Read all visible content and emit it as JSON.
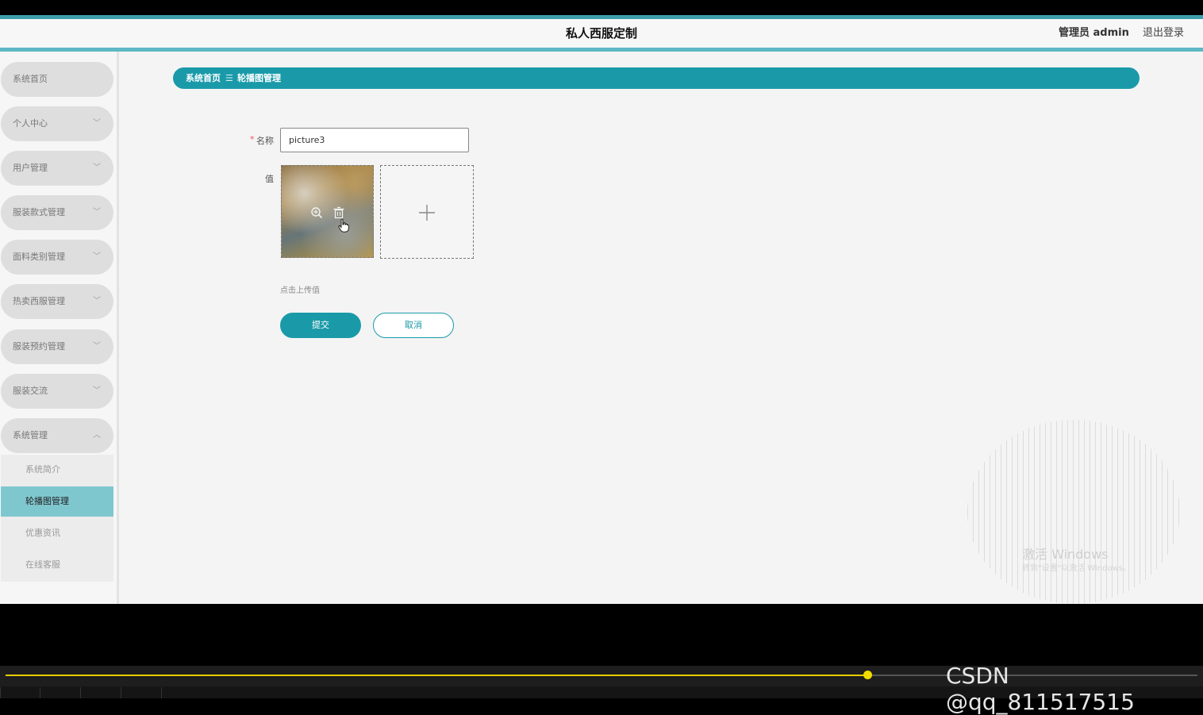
{
  "header": {
    "title": "私人西服定制",
    "user": "管理员 admin",
    "logout": "退出登录"
  },
  "sidebar": {
    "items": [
      {
        "label": "系统首页",
        "chevron": ""
      },
      {
        "label": "个人中心",
        "chevron": "﹀"
      },
      {
        "label": "用户管理",
        "chevron": "﹀"
      },
      {
        "label": "服装款式管理",
        "chevron": "﹀"
      },
      {
        "label": "面料类别管理",
        "chevron": "﹀"
      },
      {
        "label": "热卖西服管理",
        "chevron": "﹀"
      },
      {
        "label": "服装预约管理",
        "chevron": "﹀"
      },
      {
        "label": "服装交流",
        "chevron": "﹀"
      },
      {
        "label": "系统管理",
        "chevron": "︿"
      }
    ],
    "submenu": [
      {
        "label": "系统简介",
        "active": false
      },
      {
        "label": "轮播图管理",
        "active": true
      },
      {
        "label": "优惠资讯",
        "active": false
      },
      {
        "label": "在线客服",
        "active": false
      }
    ]
  },
  "breadcrumb": {
    "home": "系统首页",
    "separator": "☰",
    "current": "轮播图管理"
  },
  "form": {
    "required_mark": "*",
    "name_label": "名称",
    "name_value": "picture3",
    "value_label": "值",
    "upload_tip": "点击上传值",
    "submit": "提交",
    "cancel": "取消"
  },
  "watermark": {
    "title": "激活 Windows",
    "subtitle": "转到\"设置\"以激活 Windows。"
  },
  "player": {
    "progress": 0.723,
    "credit": "CSDN @qq_811517515"
  },
  "colors": {
    "accent": "#1a9aa9",
    "active_menu": "#7fc7cf",
    "progress": "#e5cf00"
  },
  "icons": [
    "zoom-in-icon",
    "delete-icon",
    "plus-icon",
    "chevron-down-icon",
    "chevron-up-icon",
    "hand-cursor-icon"
  ]
}
